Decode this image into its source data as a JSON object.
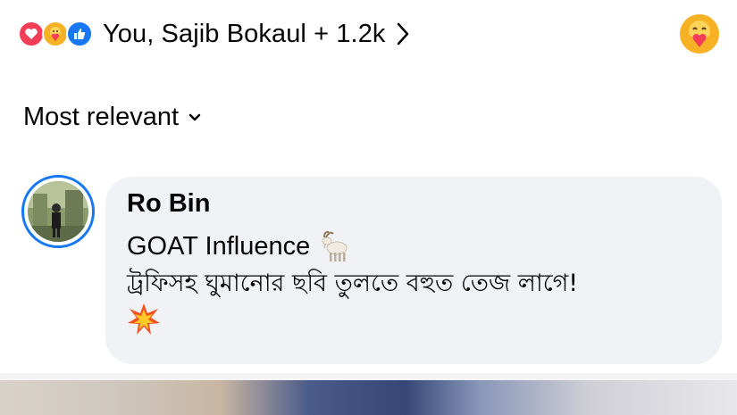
{
  "reactions": {
    "icons": [
      "love-icon",
      "care-icon",
      "like-icon"
    ],
    "summary": "You, Sajib Bokaul + 1.2k"
  },
  "sort": {
    "label": "Most relevant"
  },
  "comment": {
    "author": "Ro Bin",
    "line1": "GOAT Influence",
    "line2": "ট্রফিসহ ঘুমানোর ছবি তুলতে বহুত তেজ লাগে!",
    "line1_emoji": "goat-emoji",
    "line3_emoji": "collision-emoji"
  },
  "colors": {
    "accent": "#1877f2",
    "love": "#f33e58",
    "care": "#f7b125",
    "bubble": "#f0f2f5"
  }
}
